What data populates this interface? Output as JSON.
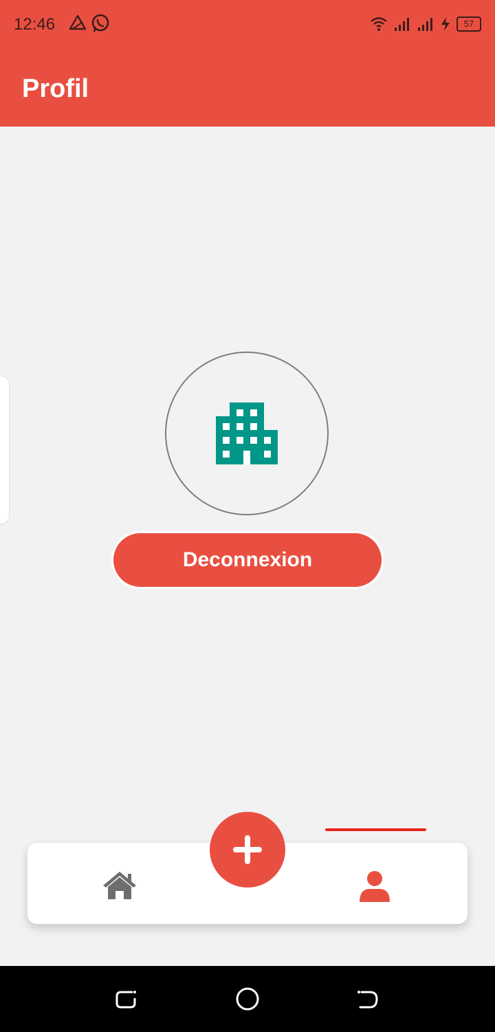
{
  "status_bar": {
    "time": "12:46",
    "battery": "57",
    "left_icons": [
      "alert-triangle-icon",
      "whatsapp-icon"
    ],
    "right_icons": [
      "wifi-icon",
      "signal-icon",
      "signal-icon",
      "charging-icon",
      "battery-icon"
    ]
  },
  "app_bar": {
    "title": "Profil",
    "color": "#e94f41"
  },
  "profile": {
    "avatar_icon": "building-icon",
    "avatar_icon_color": "#009688",
    "logout_label": "Deconnexion"
  },
  "bottom_nav": {
    "items": [
      {
        "icon": "home-icon",
        "active": false
      },
      {
        "icon": "user-icon",
        "active": true
      }
    ],
    "fab_icon": "plus-icon",
    "active_color": "#e94f41"
  },
  "system_nav": [
    "recent-apps-icon",
    "home-circle-icon",
    "back-icon"
  ]
}
